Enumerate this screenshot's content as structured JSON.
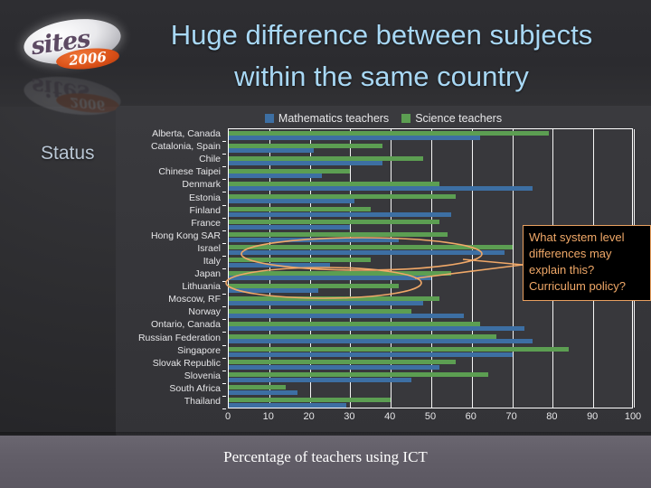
{
  "slide": {
    "title_line1": "Huge difference between subjects",
    "title_line2": "within the same country",
    "status_label": "Status",
    "caption": "Percentage of teachers using ICT",
    "logo": {
      "wordmark": "sites",
      "year": "2006"
    },
    "colors": {
      "title": "#a8d8f5",
      "math_series": "#3d6fa3",
      "science_series": "#5c9e52",
      "annotation": "#f0a868",
      "panel_bg": "#36363a",
      "bottom_band": "#625e68"
    }
  },
  "annotation": {
    "callout_line1": "What system level",
    "callout_line2": "differences may",
    "callout_line3": "explain this?",
    "callout_line4": "Curriculum policy?"
  },
  "chart_data": {
    "type": "bar",
    "orientation": "horizontal",
    "title": "",
    "xlabel": "Percentage of teachers using ICT",
    "ylabel": "",
    "xlim": [
      0,
      100
    ],
    "xticks": [
      0,
      10,
      20,
      30,
      40,
      50,
      60,
      70,
      80,
      90,
      100
    ],
    "grid": true,
    "legend_position": "top",
    "categories": [
      "Alberta, Canada",
      "Catalonia, Spain",
      "Chile",
      "Chinese Taipei",
      "Denmark",
      "Estonia",
      "Finland",
      "France",
      "Hong Kong SAR",
      "Israel",
      "Italy",
      "Japan",
      "Lithuania",
      "Moscow, RF",
      "Norway",
      "Ontario, Canada",
      "Russian Federation",
      "Singapore",
      "Slovak Republic",
      "Slovenia",
      "South Africa",
      "Thailand"
    ],
    "series": [
      {
        "name": "Mathematics teachers",
        "color": "#3d6fa3",
        "values": [
          62,
          21,
          38,
          23,
          75,
          31,
          55,
          30,
          42,
          68,
          25,
          50,
          22,
          48,
          58,
          73,
          75,
          70,
          52,
          45,
          17,
          29
        ]
      },
      {
        "name": "Science teachers",
        "color": "#5c9e52",
        "values": [
          79,
          38,
          48,
          30,
          52,
          56,
          35,
          52,
          54,
          70,
          35,
          55,
          42,
          52,
          45,
          62,
          66,
          84,
          56,
          64,
          14,
          40
        ]
      }
    ]
  }
}
